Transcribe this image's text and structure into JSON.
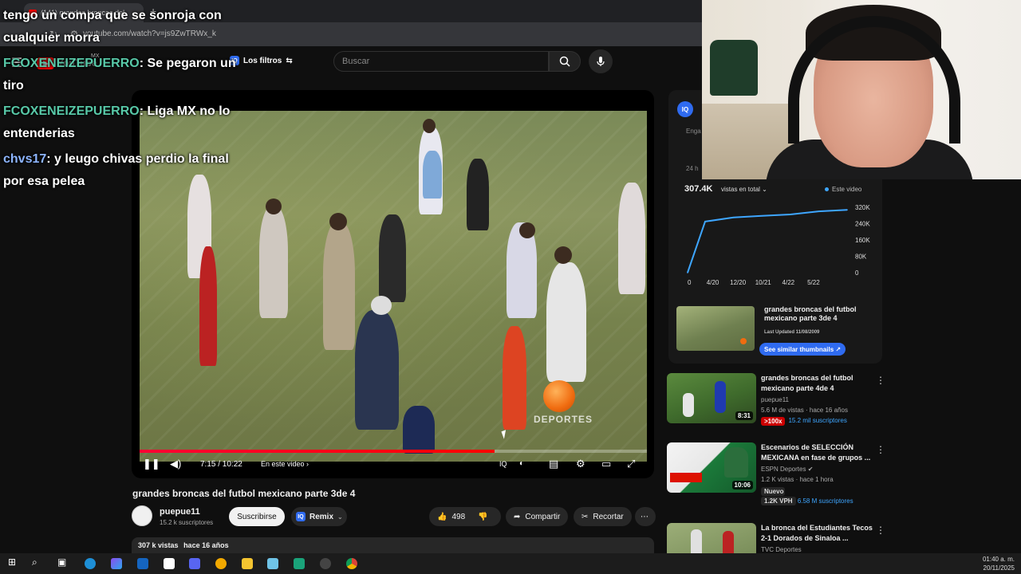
{
  "browser": {
    "tab_title": "(141) grandes broncas del",
    "url": "youtube.com/watch?v=js9ZwTRWx_k"
  },
  "header": {
    "logo_word": "YouTube",
    "country": "MX",
    "filters_label": "Los filtros",
    "search_placeholder": "Buscar"
  },
  "chat": [
    {
      "user": "",
      "text": "tengo un compa que se sonroja con cualquier morra"
    },
    {
      "user": "FCOXENEIZEPUERRO",
      "text": ": Se pegaron un tiro"
    },
    {
      "user": "FCOXENEIZEPUERRO",
      "text": ": Liga MX no lo entenderias"
    },
    {
      "user": "chvs17",
      "text": ": y leugo chivas perdio la final por esa pelea"
    }
  ],
  "player": {
    "time": "7:15 / 10:22",
    "chapter_label": "En este video",
    "progress": 0.7,
    "watermark": "DEPORTES"
  },
  "video": {
    "title": "grandes broncas del futbol mexicano parte 3de 4",
    "channel": "puepue11",
    "subscribers": "15.2 k suscriptores",
    "subscribe_label": "Suscribirse",
    "remix_label": "Remix",
    "likes": "498",
    "share_label": "Compartir",
    "clip_label": "Recortar",
    "views": "307 k vistas",
    "age": "hace 16 años"
  },
  "stats": {
    "fragment_1": "Enga",
    "fragment_2": "24 h",
    "views_total": "307.4K",
    "views_label": "vistas en total",
    "legend": "Este video",
    "chart_data": {
      "type": "line",
      "x": [
        "0",
        "4/20",
        "12/20",
        "10/21",
        "4/22",
        "5/22",
        "end"
      ],
      "x_tick_labels": [
        "0",
        "4/20",
        "12/20",
        "10/21",
        "4/22",
        "5/22"
      ],
      "values": [
        0,
        250000,
        270000,
        278000,
        285000,
        300000,
        307400
      ],
      "y_ticks": [
        "0",
        "80K",
        "160K",
        "240K",
        "320K"
      ],
      "ylim": [
        0,
        320000
      ],
      "legend": [
        "Este video"
      ],
      "color": "#3ea6ff"
    },
    "thumb_title": "grandes broncas del futbol mexicano parte 3de 4",
    "thumb_updated": "Last Updated 11/08/2009",
    "thumb_button": "See similar thumbnails"
  },
  "recommendations": [
    {
      "title": "grandes broncas del futbol mexicano parte 4de 4",
      "channel": "puepue11",
      "meta": "5.6 M de vistas · hace 16 años",
      "duration": "8:31",
      "badge": ">100x",
      "subs": "15.2 mil suscriptores"
    },
    {
      "title": "Escenarios de SELECCIÓN MEXICANA en fase de grupos ...",
      "channel": "ESPN Deportes",
      "meta": "1.2 K vistas · hace 1 hora",
      "duration": "10:06",
      "new": "Nuevo",
      "vph": "1.2K VPH",
      "subs": "6.58 M suscriptores"
    },
    {
      "title": "La bronca del Estudiantes Tecos 2-1 Dorados de Sinaloa ...",
      "channel": "TVC Deportes"
    }
  ],
  "taskbar": {
    "time": "01:40 a. m.",
    "date": "20/11/2025"
  }
}
